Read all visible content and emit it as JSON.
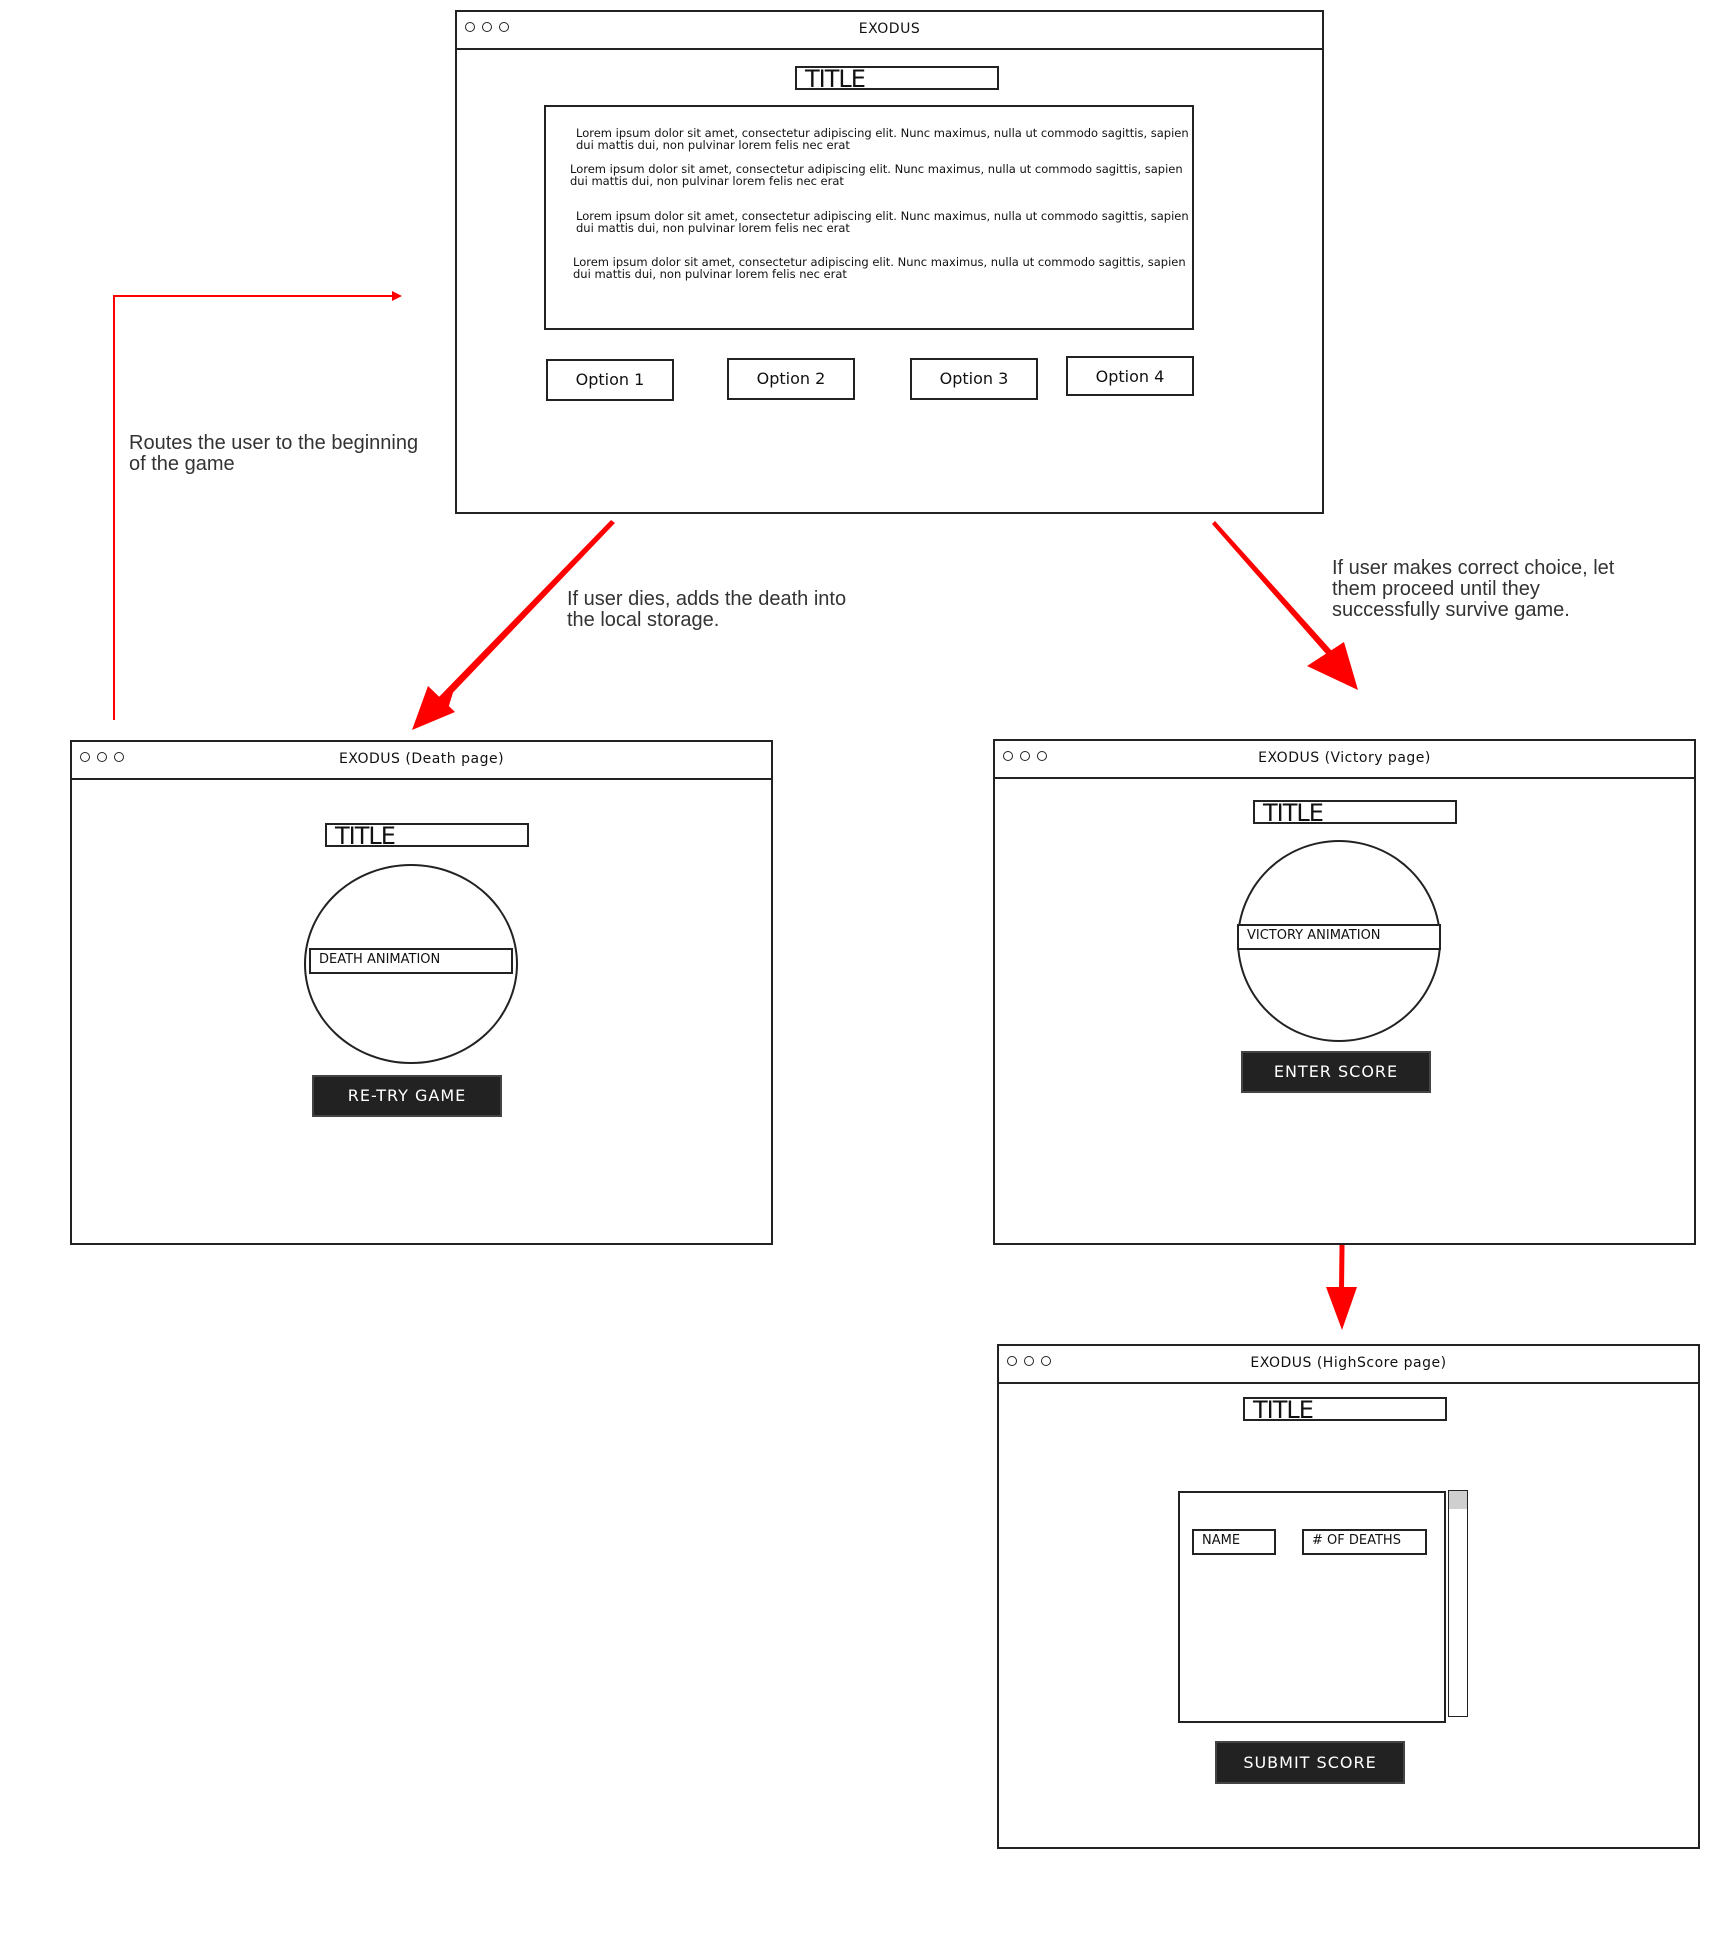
{
  "colors": {
    "arrow": "#ff0000",
    "ink": "#222222",
    "button_fill": "#222222",
    "note_text": "#333333"
  },
  "main_window": {
    "title": "EXODUS",
    "heading": "TITLE",
    "paragraphs": [
      [
        "Lorem ipsum dolor sit amet, consectetur adipiscing elit. Nunc maximus, nulla ut commodo sagittis, sapien",
        "dui mattis dui, non pulvinar lorem felis nec erat"
      ],
      [
        "Lorem ipsum dolor sit amet, consectetur adipiscing elit. Nunc maximus, nulla ut commodo sagittis, sapien",
        "dui mattis dui, non pulvinar lorem felis nec erat"
      ],
      [
        "Lorem ipsum dolor sit amet, consectetur adipiscing elit. Nunc maximus, nulla ut commodo sagittis, sapien",
        "dui mattis dui, non pulvinar lorem felis nec erat"
      ],
      [
        "Lorem ipsum dolor sit amet, consectetur adipiscing elit. Nunc maximus, nulla ut commodo sagittis, sapien",
        "dui mattis dui, non pulvinar lorem felis nec erat"
      ]
    ],
    "options": [
      "Option 1",
      "Option 2",
      "Option 3",
      "Option 4"
    ]
  },
  "death_window": {
    "title": "EXODUS (Death page)",
    "heading": "TITLE",
    "animation_label": "DEATH ANIMATION",
    "button": "RE-TRY GAME"
  },
  "victory_window": {
    "title": "EXODUS (Victory page)",
    "heading": "TITLE",
    "animation_label": "VICTORY ANIMATION",
    "button": "ENTER SCORE"
  },
  "highscore_window": {
    "title": "EXODUS (HighScore page)",
    "heading": "TITLE",
    "columns": [
      "NAME",
      "# OF DEATHS"
    ],
    "button": "SUBMIT SCORE"
  },
  "annotations": {
    "restart": [
      "Routes the user to the beginning",
      "of the game"
    ],
    "death": [
      "If user dies, adds the death into",
      "the local storage."
    ],
    "victory": [
      "If user makes correct choice, let",
      "them proceed until they",
      "successfully survive game."
    ]
  }
}
